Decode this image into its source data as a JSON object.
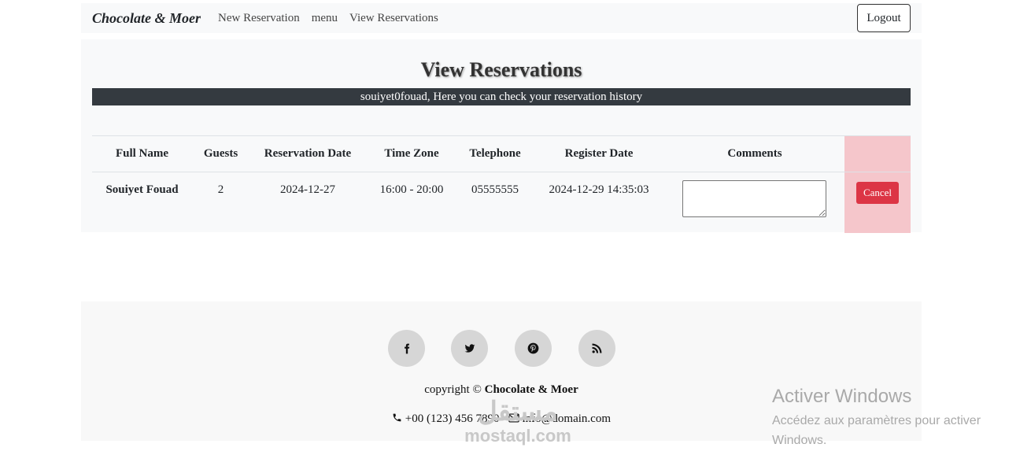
{
  "navbar": {
    "brand": "Chocolate & Moer",
    "links": [
      "New Reservation",
      "menu",
      "View Reservations"
    ],
    "logout": "Logout"
  },
  "page": {
    "title": "View Reservations",
    "subtitle": "souiyet0fouad, Here you can check your reservation history"
  },
  "table": {
    "headers": [
      "Full Name",
      "Guests",
      "Reservation Date",
      "Time Zone",
      "Telephone",
      "Register Date",
      "Comments"
    ],
    "rows": [
      {
        "full_name": "Souiyet Fouad",
        "guests": "2",
        "reservation_date": "2024-12-27",
        "time_zone": "16:00 - 20:00",
        "telephone": "05555555",
        "register_date": "2024-12-29 14:35:03",
        "comment": "",
        "cancel": "Cancel"
      }
    ]
  },
  "footer": {
    "social_icons": [
      "facebook-icon",
      "twitter-icon",
      "pinterest-icon",
      "rss-icon"
    ],
    "copyright_prefix": "copyright ©",
    "copyright_brand": "Chocolate & Moer",
    "phone": "+00 (123) 456 7890",
    "email": "info@domain.com"
  },
  "watermarks": {
    "windows_title": "Activer Windows",
    "windows_sub": "Accédez aux paramètres pour activer Windows.",
    "mostaql_ar": "مستقل",
    "mostaql_en": "mostaql.com"
  },
  "colors": {
    "navbar_bg": "#f8f9fa",
    "subtitle_bg": "#343a40",
    "cancel_btn": "#dc3545",
    "action_col_bg": "#f5c6cb",
    "social_bg": "#d6d6d6"
  }
}
